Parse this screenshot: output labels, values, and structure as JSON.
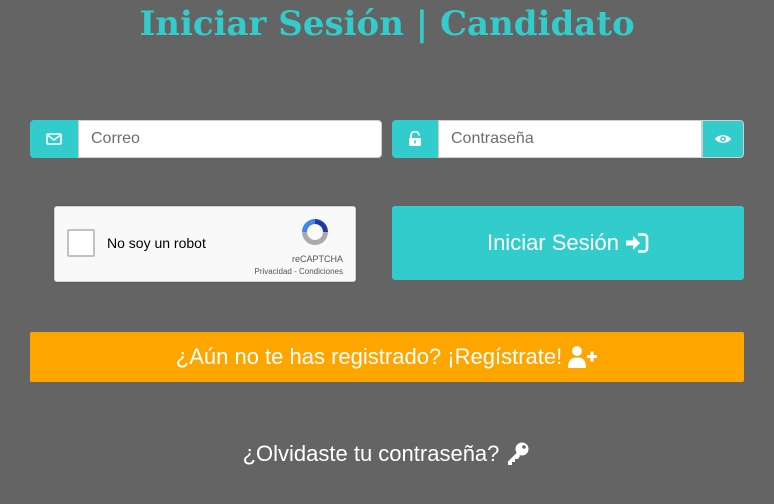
{
  "page": {
    "title": "Iniciar Sesión | Candidato"
  },
  "login_form": {
    "email": {
      "placeholder": "Correo",
      "value": "",
      "icon": "envelope-icon"
    },
    "password": {
      "placeholder": "Contraseña",
      "value": "",
      "icon": "unlock-icon",
      "toggle_icon": "eye-icon"
    }
  },
  "recaptcha": {
    "label": "No soy un robot",
    "brand": "reCAPTCHA",
    "links": "Privacidad - Condiciones"
  },
  "buttons": {
    "login_label": "Iniciar Sesión",
    "register_label": "¿Aún no te has registrado? ¡Regístrate!",
    "forgot_label": "¿Olvidaste tu contraseña?"
  },
  "colors": {
    "background": "#646464",
    "accent": "#33cccc",
    "register": "#ffa500"
  }
}
